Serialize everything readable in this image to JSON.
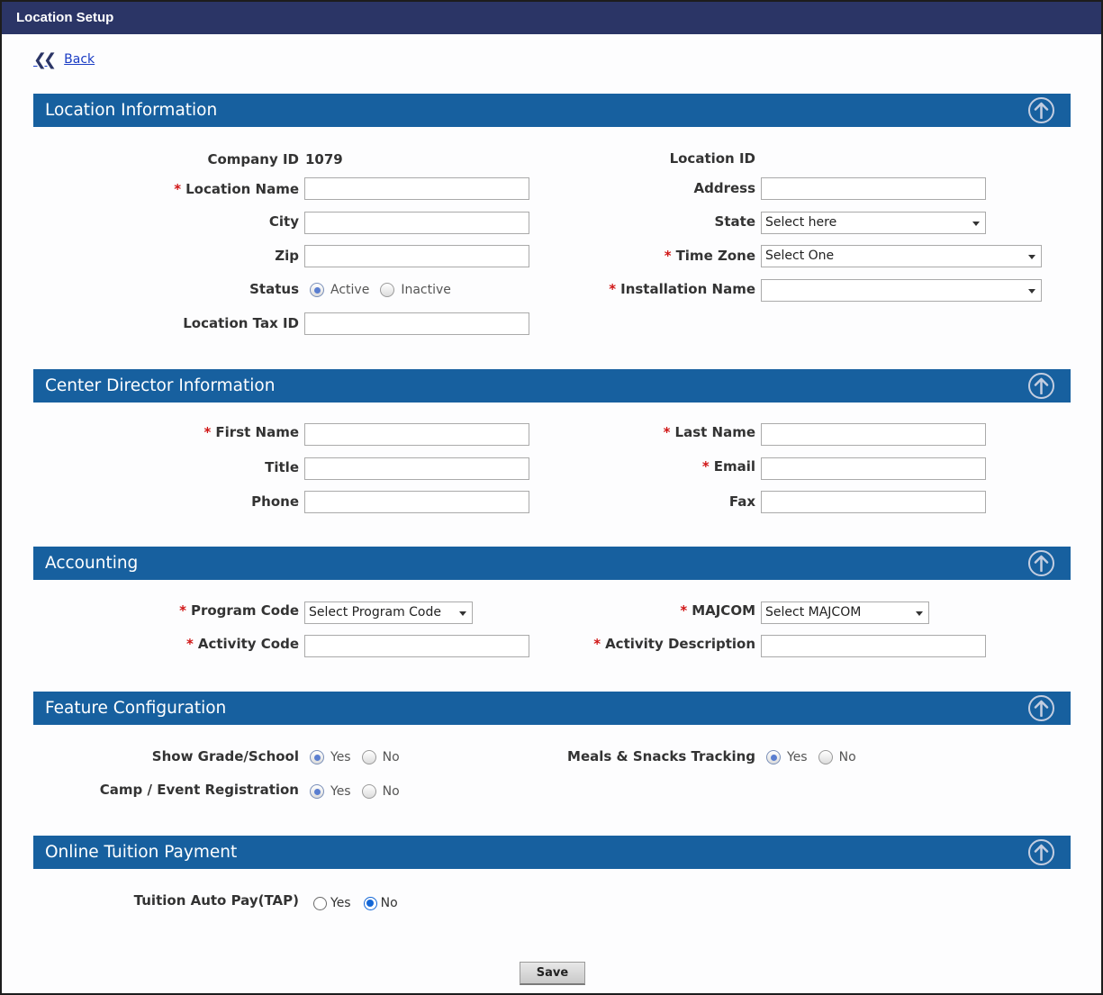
{
  "window": {
    "title": "Location Setup"
  },
  "back": {
    "label": "Back"
  },
  "sections": {
    "location": "Location Information",
    "director": "Center Director Information",
    "accounting": "Accounting",
    "features": "Feature Configuration",
    "tuition": "Online Tuition Payment"
  },
  "location": {
    "company_id_label": "Company ID",
    "company_id_value": "1079",
    "location_id_label": "Location ID",
    "location_name_label": "Location Name",
    "address_label": "Address",
    "city_label": "City",
    "state_label": "State",
    "state_value": "Select here",
    "zip_label": "Zip",
    "time_zone_label": "Time Zone",
    "time_zone_value": "Select One",
    "status_label": "Status",
    "status_options": [
      "Active",
      "Inactive"
    ],
    "status_selected": "Active",
    "installation_label": "Installation Name",
    "installation_value": "",
    "tax_id_label": "Location Tax ID"
  },
  "director": {
    "first_name_label": "First Name",
    "last_name_label": "Last Name",
    "title_label": "Title",
    "email_label": "Email",
    "phone_label": "Phone",
    "fax_label": "Fax"
  },
  "accounting": {
    "program_code_label": "Program Code",
    "program_code_value": "Select Program Code",
    "majcom_label": "MAJCOM",
    "majcom_value": "Select MAJCOM",
    "activity_code_label": "Activity Code",
    "activity_desc_label": "Activity Description"
  },
  "features": {
    "grade_label": "Show Grade/School",
    "meals_label": "Meals & Snacks Tracking",
    "camp_label": "Camp / Event Registration",
    "yes": "Yes",
    "no": "No",
    "grade_selected": "Yes",
    "meals_selected": "Yes",
    "camp_selected": "Yes"
  },
  "tuition": {
    "tap_label": "Tuition Auto Pay(TAP)",
    "yes": "Yes",
    "no": "No",
    "tap_selected": "No"
  },
  "save": {
    "label": "Save"
  },
  "required_marker": "*",
  "colors": {
    "titlebar": "#2b3566",
    "section": "#17609f",
    "required": "#d01515"
  }
}
